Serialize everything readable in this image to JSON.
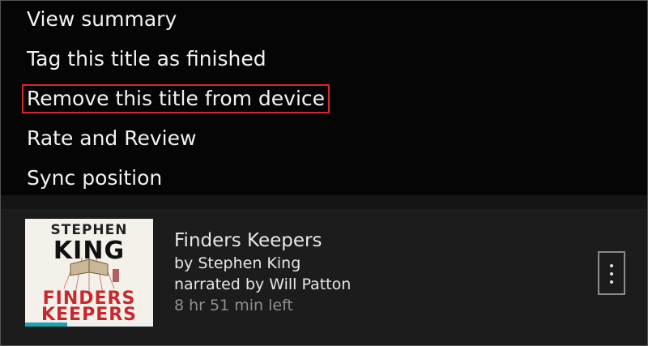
{
  "menu": {
    "items": [
      {
        "label": "View summary"
      },
      {
        "label": "Tag this title as finished"
      },
      {
        "label": "Remove this title from device"
      },
      {
        "label": "Rate and Review"
      },
      {
        "label": "Sync position"
      }
    ]
  },
  "book": {
    "title": "Finders Keepers",
    "author": "by Stephen King",
    "narrator": "narrated by Will Patton",
    "time_left": "8 hr 51 min left",
    "progress": 0.33,
    "cover": {
      "author_line1": "STEPHEN",
      "author_line2": "KING",
      "title_line1": "FINDERS",
      "title_line2": "KEEPERS"
    },
    "more_icon": "more-vertical-icon"
  },
  "colors": {
    "highlight": "#d8262c",
    "progress": "#1fa2b5"
  }
}
